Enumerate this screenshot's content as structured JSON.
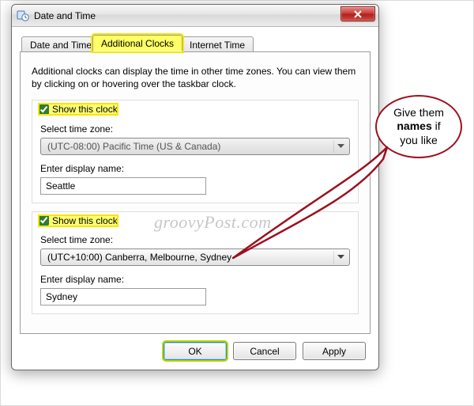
{
  "window": {
    "title": "Date and Time"
  },
  "tabs": {
    "t0": "Date and Time",
    "t1": "Additional Clocks",
    "t2": "Internet Time"
  },
  "intro": "Additional clocks can display the time in other time zones. You can view them by clicking on or hovering over the taskbar clock.",
  "clock1": {
    "checkbox_label": "Show this clock",
    "tz_label": "Select time zone:",
    "tz_value": "(UTC-08:00) Pacific Time (US & Canada)",
    "name_label": "Enter display name:",
    "name_value": "Seattle"
  },
  "clock2": {
    "checkbox_label": "Show this clock",
    "tz_label": "Select time zone:",
    "tz_value": "(UTC+10:00) Canberra, Melbourne, Sydney",
    "name_label": "Enter display name:",
    "name_value": "Sydney"
  },
  "buttons": {
    "ok": "OK",
    "cancel": "Cancel",
    "apply": "Apply"
  },
  "callout": {
    "line1": "Give them",
    "line2_strong": "names",
    "line2_rest": " if",
    "line3": "you like"
  },
  "watermark": "groovyPost.com"
}
